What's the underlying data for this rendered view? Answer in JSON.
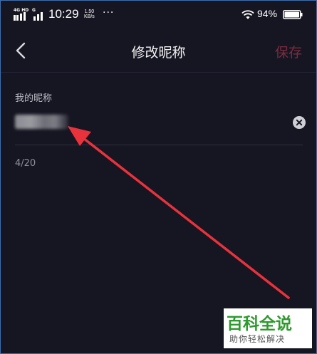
{
  "status_bar": {
    "network": "4G HD",
    "network2": "G",
    "time": "10:29",
    "speed_value": "1.50",
    "speed_unit": "KB/s",
    "more": "···",
    "battery": "94%"
  },
  "header": {
    "title": "修改昵称",
    "save_label": "保存"
  },
  "form": {
    "label": "我的昵称",
    "value": "",
    "counter": "4/20"
  },
  "watermark": {
    "title": "百科全说",
    "subtitle": "助你轻松解决"
  },
  "colors": {
    "background": "#161622",
    "save_disabled": "#7a2d3f",
    "annotation_arrow": "#e8323c",
    "watermark_green": "#2f9a2f"
  }
}
